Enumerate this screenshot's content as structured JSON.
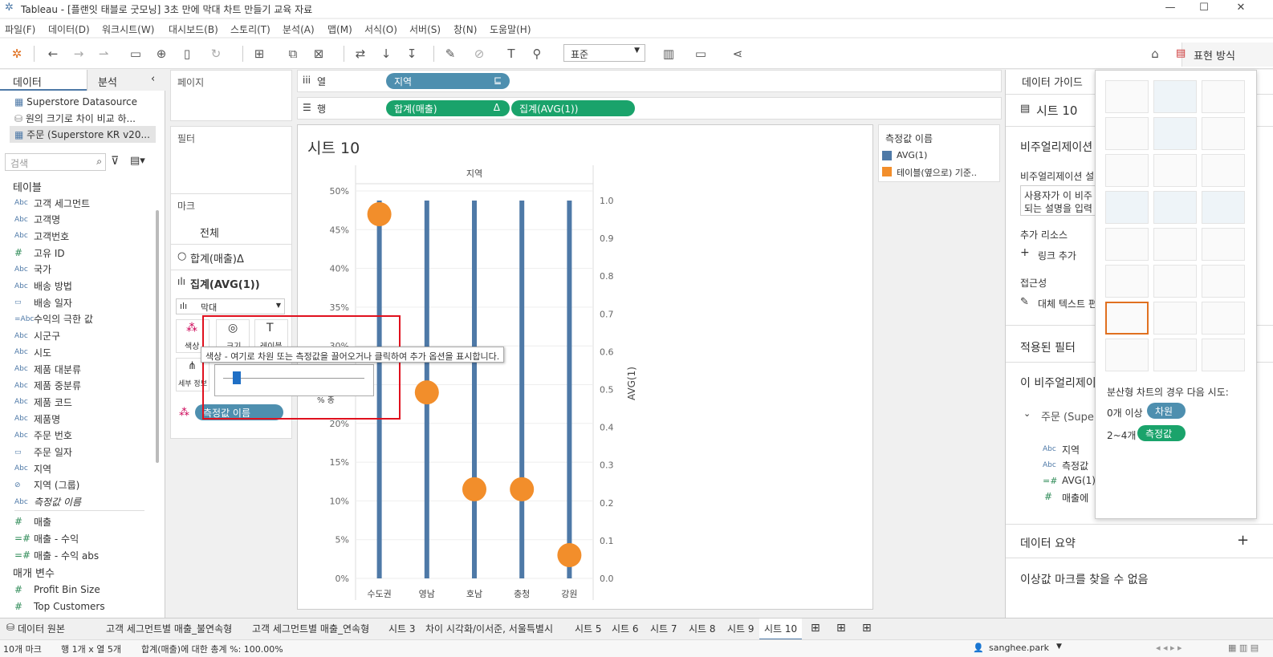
{
  "window": {
    "title": "Tableau - [플랜잇 태블로 굿모닝] 3초 만에 막대 차트 만들기 교육 자료",
    "minimize": "—",
    "maximize": "☐",
    "close": "✕"
  },
  "menu": [
    "파일(F)",
    "데이터(D)",
    "워크시트(W)",
    "대시보드(B)",
    "스토리(T)",
    "분석(A)",
    "맵(M)",
    "서식(O)",
    "서버(S)",
    "창(N)",
    "도움말(H)"
  ],
  "toolbar": {
    "standard": "표준",
    "format_label": "표현 방식"
  },
  "left": {
    "tab_data": "데이터",
    "tab_analysis": "분석",
    "datasources": [
      "Superstore Datasource",
      "원의 크기로 차이 비교 하...",
      "주문 (Superstore KR v20..."
    ],
    "search_placeholder": "검색",
    "tables_header": "테이블",
    "fields": [
      {
        "t": "Abc",
        "n": "고객 세그먼트"
      },
      {
        "t": "Abc",
        "n": "고객명"
      },
      {
        "t": "Abc",
        "n": "고객번호"
      },
      {
        "t": "#",
        "n": "고유 ID"
      },
      {
        "t": "Abc",
        "n": "국가"
      },
      {
        "t": "Abc",
        "n": "배송 방법"
      },
      {
        "t": "▭",
        "n": "배송 일자"
      },
      {
        "t": "=Abc",
        "n": "수익의 극한 값"
      },
      {
        "t": "Abc",
        "n": "시군구"
      },
      {
        "t": "Abc",
        "n": "시도"
      },
      {
        "t": "Abc",
        "n": "제품 대분류"
      },
      {
        "t": "Abc",
        "n": "제품 중분류"
      },
      {
        "t": "Abc",
        "n": "제품 코드"
      },
      {
        "t": "Abc",
        "n": "제품명"
      },
      {
        "t": "Abc",
        "n": "주문 번호"
      },
      {
        "t": "▭",
        "n": "주문 일자"
      },
      {
        "t": "Abc",
        "n": "지역"
      },
      {
        "t": "⊘",
        "n": "지역 (그룹)"
      },
      {
        "t": "Abc",
        "n": "측정값 이름"
      }
    ],
    "measures": [
      {
        "t": "#",
        "n": "매출"
      },
      {
        "t": "=#",
        "n": "매출 - 수익"
      },
      {
        "t": "=#",
        "n": "매출 - 수익 abs"
      }
    ],
    "params_header": "매개 변수",
    "params": [
      {
        "t": "#",
        "n": "Profit Bin Size"
      },
      {
        "t": "#",
        "n": "Top Customers"
      }
    ]
  },
  "shelves": {
    "pages": "페이지",
    "filters": "필터",
    "marks": "마크",
    "all": "전체",
    "mark1": "합계(매출)Δ",
    "mark2": "집계(AVG(1))",
    "marktype": "막대",
    "color": "색상",
    "size": "크기",
    "label": "레이블",
    "detail": "세부 정보",
    "measure_pill": "측정값 이름",
    "columns_label": "열",
    "rows_label": "행",
    "col_pill": "지역",
    "row_pill1": "합계(매출)",
    "row_pill2": "집계(AVG(1))",
    "delta": "Δ"
  },
  "tooltip": "색상 - 여기로 차원 또는 측정값을 끌어오거나 클릭하여 추가 옵션을 표시합니다.",
  "view": {
    "sheet_title": "시트 10"
  },
  "legend": {
    "title": "측정값 이름",
    "items": [
      "AVG(1)",
      "테이블(옆으로) 기준.."
    ]
  },
  "colors": {
    "blue": "#4e79a7",
    "orange": "#f28e2b",
    "green": "#1aa36b",
    "pillblue": "#4e8faf"
  },
  "chart_data": {
    "type": "bar",
    "xlabel": "지역",
    "categories": [
      "수도권",
      "영남",
      "호남",
      "충청",
      "강원"
    ],
    "series": [
      {
        "name": "AVG(1)",
        "values": [
          1.0,
          1.0,
          1.0,
          1.0,
          1.0
        ],
        "axis": "right"
      },
      {
        "name": "테이블(옆으로) 기준..",
        "values": [
          0.47,
          0.24,
          0.115,
          0.115,
          0.03
        ],
        "axis": "left"
      }
    ],
    "left_ticks": [
      "0%",
      "5%",
      "10%",
      "15%",
      "20%",
      "25%",
      "30%",
      "35%",
      "40%",
      "45%",
      "50%"
    ],
    "right_ticks": [
      "0.0",
      "0.1",
      "0.2",
      "0.3",
      "0.4",
      "0.5",
      "0.6",
      "0.7",
      "0.8",
      "0.9",
      "1.0"
    ],
    "right_label": "AVG(1)",
    "left_label_partial": "% 총",
    "ylim_left": [
      0,
      0.5
    ],
    "ylim_right": [
      0,
      1.0
    ]
  },
  "right": {
    "guide": "데이터 가이드",
    "sheet": "시트 10",
    "viz_heading": "비주얼리제이션",
    "viz_desc": "비주얼리제이션 설",
    "desc_box1": "사용자가 이 비주",
    "desc_box2": "되는 설명을 입력",
    "resources": "추가 리소스",
    "add_link": "링크 추가",
    "access": "접근성",
    "alt_text": "대체 텍스트 편",
    "applied_filters": "적용된 필터",
    "this_viz": "이 비주얼리제이",
    "ds_short": "주문 (Supe",
    "fields": [
      "지역",
      "측정값",
      "AVG(1)",
      "매출에"
    ],
    "summary": "데이터 요약",
    "plus": "+",
    "outliers": "이상값 마크를 찾을 수 없음"
  },
  "showme": {
    "hint": "분산형 차트의 경우 다음 시도:",
    "line1": "0개 이상",
    "pill1": "차원",
    "line2": "2~4개",
    "pill2": "측정값"
  },
  "bottom": {
    "datasource": "데이터 원본",
    "tabs": [
      "고객 세그먼트별 매출_불연속형",
      "고객 세그먼트별 매출_연속형",
      "시트 3",
      "차이 시각화/이서준, 서울특별시",
      "시트 5",
      "시트 6",
      "시트 7",
      "시트 8",
      "시트 9",
      "시트 10"
    ]
  },
  "status": {
    "marks": "10개 마크",
    "rows": "행 1개 x 열 5개",
    "sum": "합계(매출)에 대한 총계 %: 100.00%",
    "user": "sanghee.park"
  }
}
